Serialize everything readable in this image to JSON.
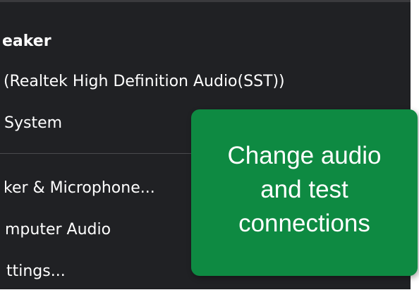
{
  "menu": {
    "section_heading": "eaker",
    "items": [
      {
        "label": "(Realtek High Definition Audio(SST))"
      },
      {
        "label": "System"
      },
      {
        "label": "ker & Microphone..."
      },
      {
        "label": "mputer Audio"
      },
      {
        "label": "ttings..."
      }
    ]
  },
  "tooltip": {
    "line1": "Change audio",
    "line2": "and test",
    "line3": "connections",
    "background_color": "#0e8a42"
  },
  "colors": {
    "menu_background": "#202124",
    "text": "#ffffff"
  }
}
